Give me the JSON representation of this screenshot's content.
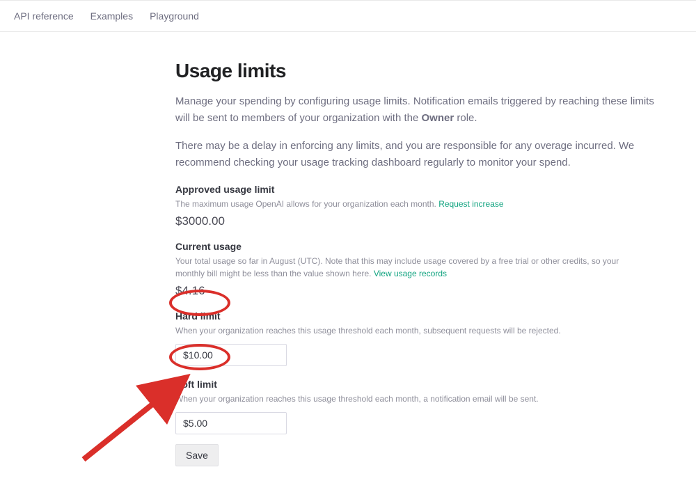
{
  "nav": {
    "items": [
      {
        "label": "API reference"
      },
      {
        "label": "Examples"
      },
      {
        "label": "Playground"
      }
    ]
  },
  "page": {
    "title": "Usage limits",
    "intro1_pre": "Manage your spending by configuring usage limits. Notification emails triggered by reaching these limits will be sent to members of your organization with the ",
    "intro1_bold": "Owner",
    "intro1_post": " role.",
    "intro2": "There may be a delay in enforcing any limits, and you are responsible for any overage incurred. We recommend checking your usage tracking dashboard regularly to monitor your spend."
  },
  "approved": {
    "heading": "Approved usage limit",
    "subtext": "The maximum usage OpenAI allows for your organization each month. ",
    "link": "Request increase",
    "value": "$3000.00"
  },
  "current": {
    "heading": "Current usage",
    "subtext": "Your total usage so far in August (UTC). Note that this may include usage covered by a free trial or other credits, so your monthly bill might be less than the value shown here. ",
    "link": "View usage records",
    "value": "$4.16"
  },
  "hard": {
    "heading": "Hard limit",
    "subtext": "When your organization reaches this usage threshold each month, subsequent requests will be rejected.",
    "value": "$10.00"
  },
  "soft": {
    "heading": "Soft limit",
    "subtext": "When your organization reaches this usage threshold each month, a notification email will be sent.",
    "value": "$5.00"
  },
  "save_label": "Save"
}
